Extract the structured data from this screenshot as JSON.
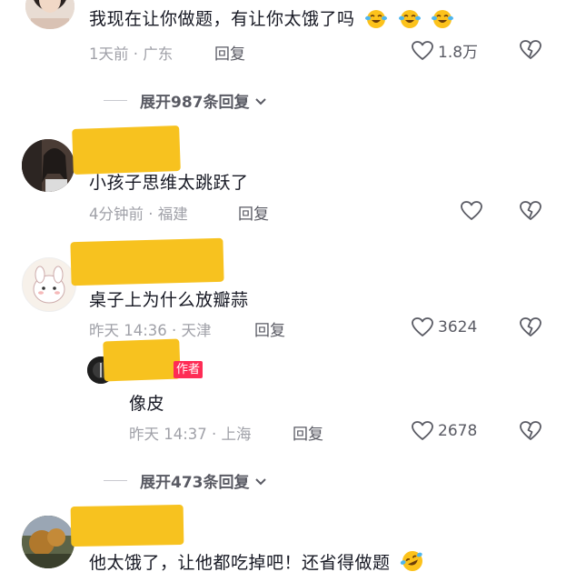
{
  "comments": [
    {
      "text": "我现在让你做题，有让你太饿了吗",
      "emoji_count": 3,
      "emoji_name": "crying-laughing-emoji-icon",
      "meta": "1天前 · 广东",
      "reply_label": "回复",
      "likes": "1.8万",
      "expand_label": "展开987条回复"
    },
    {
      "text": "小孩子思维太跳跃了",
      "meta": "4分钟前 · 福建",
      "reply_label": "回复",
      "likes": ""
    },
    {
      "text": "桌子上为什么放瓣蒜",
      "meta": "昨天 14:36 · 天津",
      "reply_label": "回复",
      "likes": "3624",
      "reply": {
        "badge": "作者",
        "text": "像皮",
        "meta": "昨天 14:37 · 上海",
        "reply_label": "回复",
        "likes": "2678"
      },
      "expand_label": "展开473条回复"
    },
    {
      "text": "他太饿了，让他都吃掉吧！还省得做题",
      "emoji_name": "rolling-laughing-emoji-icon"
    }
  ],
  "colors": {
    "text": "#161823",
    "meta": "#a0a1a8",
    "secondary": "#595a63",
    "redaction": "#f7c21f",
    "author_badge": "#fe2c55"
  }
}
